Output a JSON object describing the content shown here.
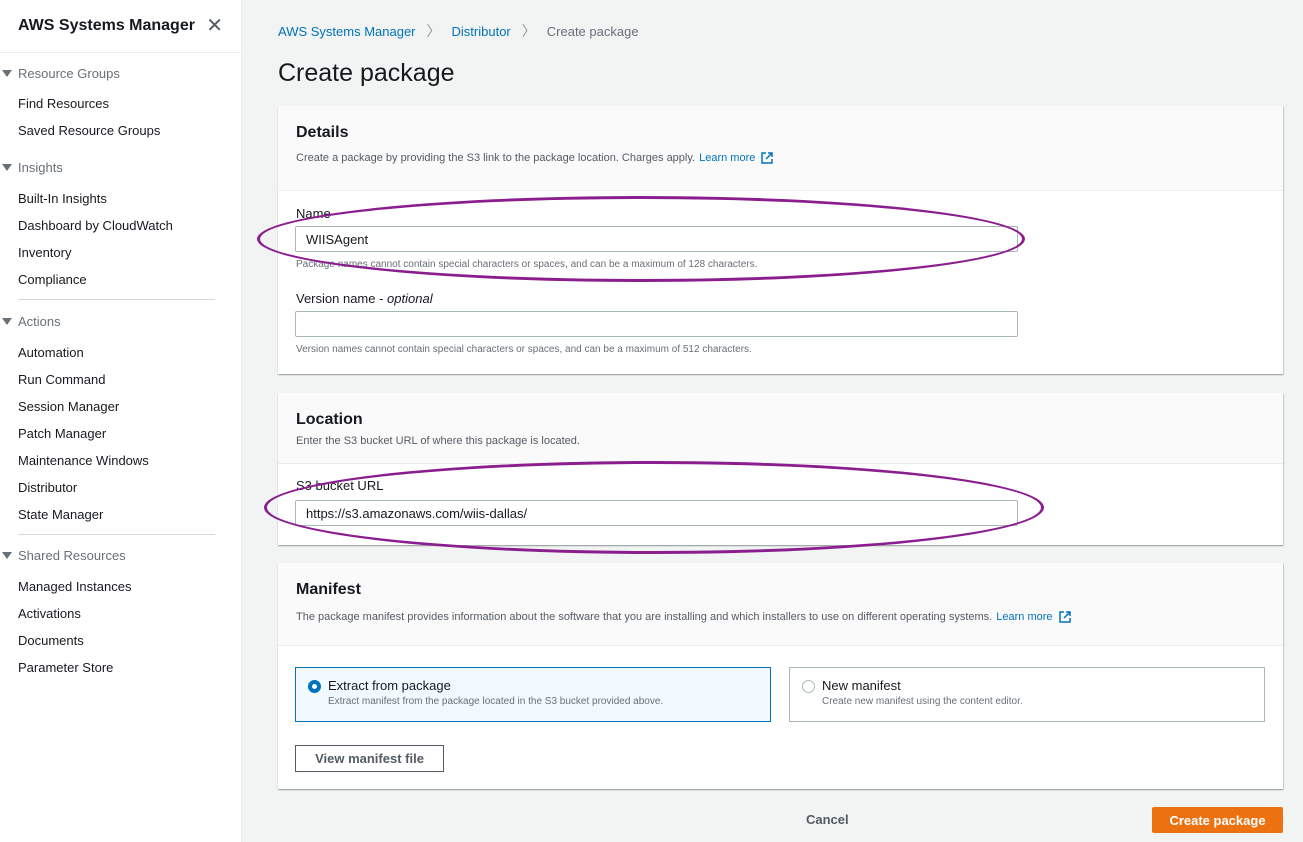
{
  "sidebar": {
    "title": "AWS Systems Manager",
    "close_icon": "close-icon",
    "sections": [
      {
        "label": "Resource Groups",
        "items": [
          "Find Resources",
          "Saved Resource Groups"
        ]
      },
      {
        "label": "Insights",
        "items": [
          "Built-In Insights",
          "Dashboard by CloudWatch",
          "Inventory",
          "Compliance"
        ]
      },
      {
        "label": "Actions",
        "items": [
          "Automation",
          "Run Command",
          "Session Manager",
          "Patch Manager",
          "Maintenance Windows",
          "Distributor",
          "State Manager"
        ]
      },
      {
        "label": "Shared Resources",
        "items": [
          "Managed Instances",
          "Activations",
          "Documents",
          "Parameter Store"
        ]
      }
    ]
  },
  "breadcrumb": {
    "items": [
      "AWS Systems Manager",
      "Distributor"
    ],
    "current": "Create package"
  },
  "page_title": "Create package",
  "details": {
    "title": "Details",
    "description": "Create a package by providing the S3 link to the package location. Charges apply.",
    "learn_more": "Learn more",
    "name_label": "Name",
    "name_value": "WIISAgent",
    "name_hint": "Package names cannot contain special characters or spaces, and can be a maximum of 128 characters.",
    "version_label": "Version name - ",
    "version_optional": "optional",
    "version_value": "",
    "version_hint": "Version names cannot contain special characters or spaces, and can be a maximum of 512 characters."
  },
  "location": {
    "title": "Location",
    "description": "Enter the S3 bucket URL of where this package is located.",
    "url_label": "S3 bucket URL",
    "url_value": "https://s3.amazonaws.com/wiis-dallas/"
  },
  "manifest": {
    "title": "Manifest",
    "description": "The package manifest provides information about the software that you are installing and which installers to use on different operating systems.",
    "learn_more": "Learn more",
    "options": [
      {
        "title": "Extract from package",
        "subtitle": "Extract manifest from the package located in the S3 bucket provided above.",
        "selected": true
      },
      {
        "title": "New manifest",
        "subtitle": "Create new manifest using the content editor.",
        "selected": false
      }
    ],
    "view_button": "View manifest file"
  },
  "footer": {
    "cancel": "Cancel",
    "create": "Create package"
  },
  "colors": {
    "primary": "#ec7211",
    "link": "#0073bb",
    "highlight_oval": "#8b1e8e"
  }
}
